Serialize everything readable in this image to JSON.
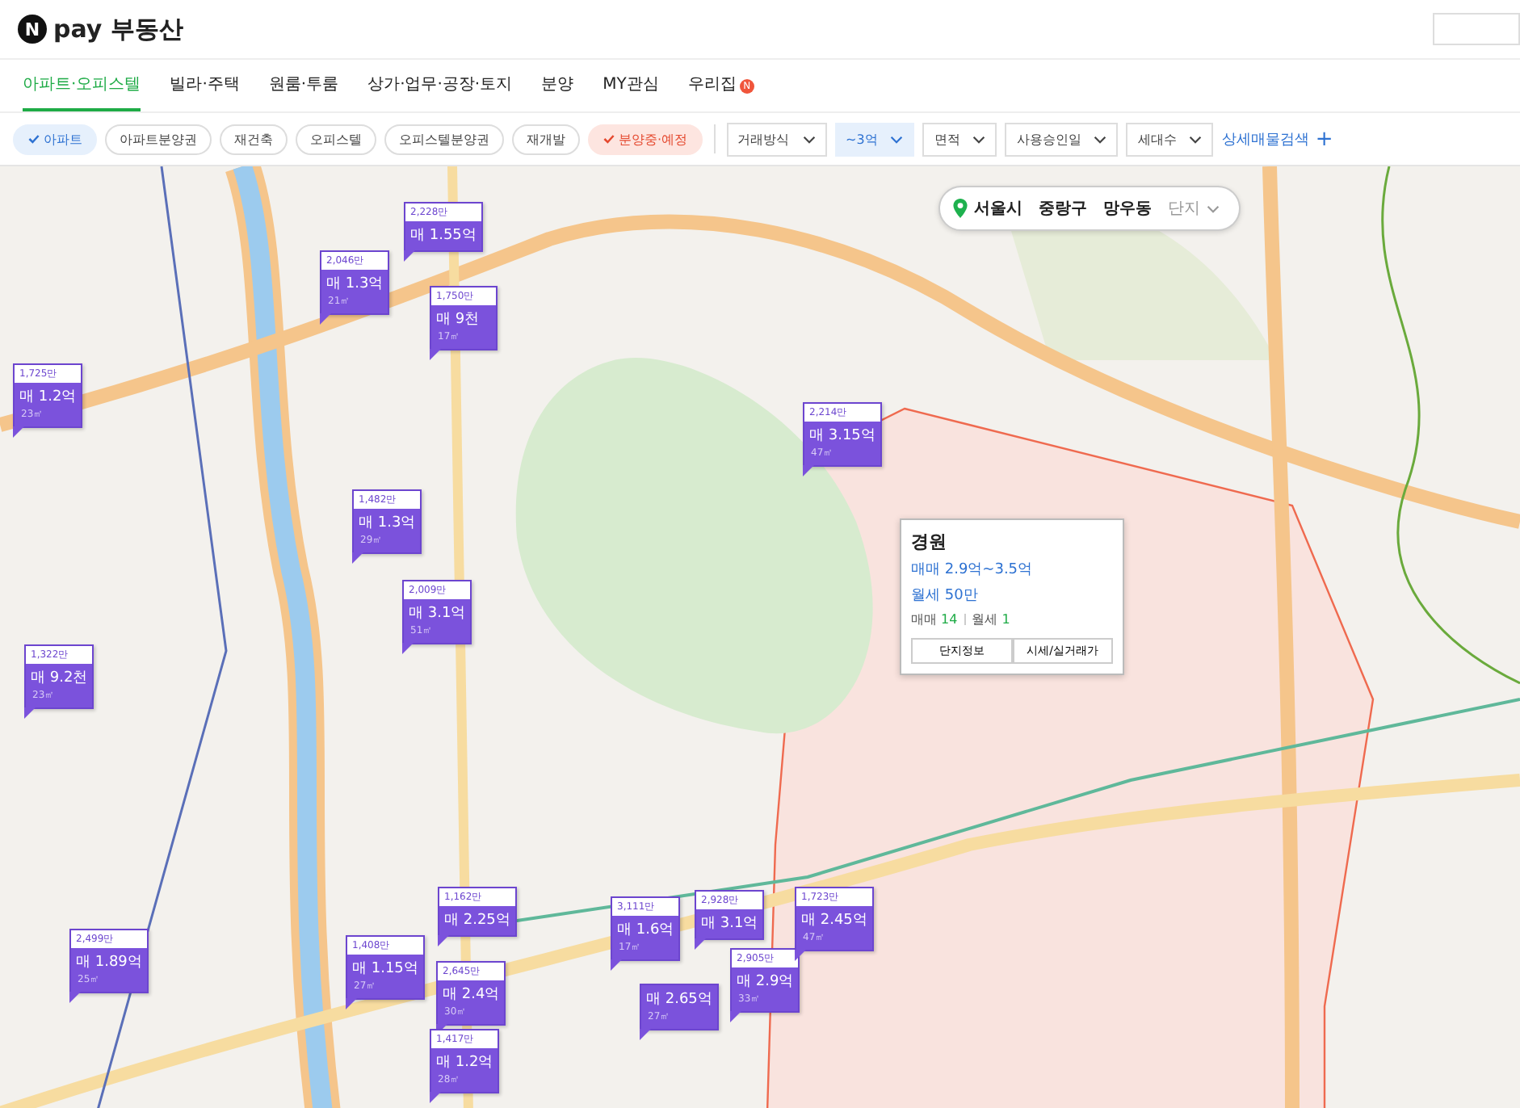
{
  "header": {
    "logo_badge": "N",
    "logo_text": "pay 부동산"
  },
  "tabs": [
    {
      "label": "아파트·오피스텔",
      "selected": true
    },
    {
      "label": "빌라·주택",
      "selected": false
    },
    {
      "label": "원룸·투룸",
      "selected": false
    },
    {
      "label": "상가·업무·공장·토지",
      "selected": false
    },
    {
      "label": "분양",
      "selected": false
    },
    {
      "label": "MY관심",
      "selected": false
    },
    {
      "label": "우리집",
      "selected": false,
      "badge": "N"
    }
  ],
  "chips": [
    {
      "label": "아파트",
      "selected": true,
      "kind": "type"
    },
    {
      "label": "아파트분양권",
      "selected": false,
      "kind": "type"
    },
    {
      "label": "재건축",
      "selected": false,
      "kind": "type"
    },
    {
      "label": "오피스텔",
      "selected": false,
      "kind": "type"
    },
    {
      "label": "오피스텔분양권",
      "selected": false,
      "kind": "type"
    },
    {
      "label": "재개발",
      "selected": false,
      "kind": "type"
    },
    {
      "label": "분양중·예정",
      "selected": true,
      "kind": "sale"
    }
  ],
  "dropdowns": [
    {
      "label": "거래방식",
      "selected": false
    },
    {
      "label": "~3억",
      "selected": true
    },
    {
      "label": "면적",
      "selected": false
    },
    {
      "label": "사용승인일",
      "selected": false
    },
    {
      "label": "세대수",
      "selected": false
    }
  ],
  "detail_search": {
    "label": "상세매물검색",
    "icon": "+"
  },
  "breadcrumb": {
    "items": [
      "서울시",
      "중랑구",
      "망우동"
    ],
    "last": "단지"
  },
  "markers": [
    {
      "unit": "1,725만",
      "price": "매 1.2억",
      "area": "23㎡"
    },
    {
      "unit": "2,228만",
      "price": "매 1.55억"
    },
    {
      "unit": "2,046만",
      "price": "매 1.3억",
      "area": "21㎡"
    },
    {
      "unit": "1,750만",
      "price": "매 9천",
      "area": "17㎡"
    },
    {
      "unit": "1,482만",
      "price": "매 1.3억",
      "area": "29㎡"
    },
    {
      "unit": "2,009만",
      "price": "매 3.1억",
      "area": "51㎡"
    },
    {
      "unit": "2,214만",
      "price": "매 3.15억",
      "area": "47㎡"
    },
    {
      "unit": "1,322만",
      "price": "매 9.2천",
      "area": "23㎡"
    },
    {
      "unit": "2,499만",
      "price": "매 1.89억",
      "area": "25㎡"
    },
    {
      "unit": "1,408만",
      "price": "매 1.15억",
      "area": "27㎡"
    },
    {
      "unit": "1,162만",
      "price": "매 2.25억"
    },
    {
      "unit": "2,645만",
      "price": "매 2.4억",
      "area": "30㎡"
    },
    {
      "unit": "1,417만",
      "price": "매 1.2억",
      "area": "28㎡"
    },
    {
      "unit": "3,111만",
      "price": "매 1.6억",
      "area": "17㎡"
    },
    {
      "unit": "2,928만",
      "price": "매 3.1억"
    },
    {
      "price": "매 2.65억",
      "area": "27㎡"
    },
    {
      "unit": "2,905만",
      "price": "매 2.9억",
      "area": "33㎡"
    },
    {
      "unit": "1,723만",
      "price": "매 2.45억",
      "area": "47㎡"
    }
  ],
  "popup": {
    "title": "경원",
    "sale_range": "매매 2.9억~3.5억",
    "rent": "월세 50만",
    "counts": [
      {
        "label": "매매",
        "value": "14"
      },
      {
        "label": "월세",
        "value": "1"
      }
    ],
    "buttons": [
      "단지정보",
      "시세/실거래가"
    ]
  }
}
